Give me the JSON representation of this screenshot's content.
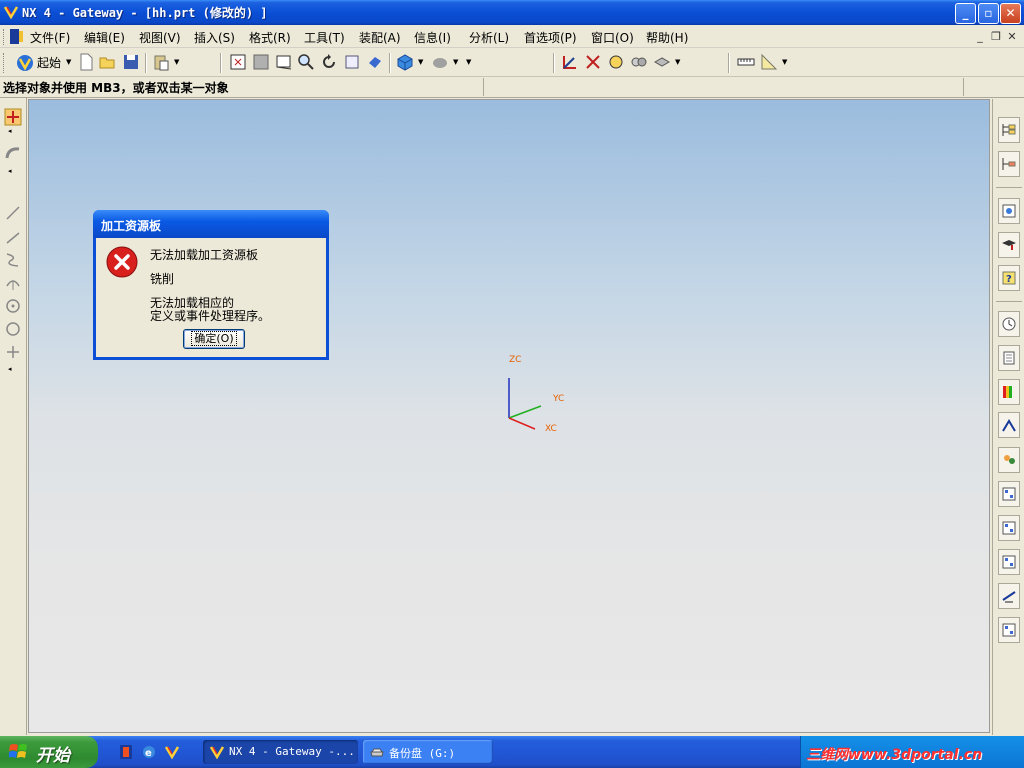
{
  "window": {
    "title": "NX 4 - Gateway - [hh.prt (修改的) ]"
  },
  "menu": {
    "items": [
      "文件(F)",
      "编辑(E)",
      "视图(V)",
      "插入(S)",
      "格式(R)",
      "工具(T)",
      "装配(A)",
      "信息(I)",
      "分析(L)",
      "首选项(P)",
      "窗口(O)",
      "帮助(H)"
    ]
  },
  "toolbar": {
    "start_label": "起始"
  },
  "cue": {
    "text": "选择对象并使用 MB3，或者双击某一对象"
  },
  "triad": {
    "zc": "ZC",
    "yc": "YC",
    "xc": "XC"
  },
  "dialog": {
    "title": "加工资源板",
    "line1": "无法加载加工资源板",
    "line2": "铣削",
    "line3": "无法加载相应的",
    "line4": "定义或事件处理程序。",
    "ok_label": "确定(O)"
  },
  "taskbar": {
    "start_label": "开始",
    "task1": "NX 4 - Gateway -...",
    "task2": "备份盘 (G:)",
    "watermark": "三维网www.3dportal.cn"
  },
  "colors": {
    "titlebar": "#0a4fd6",
    "error_icon": "#d8201c",
    "axis_x": "#e02020",
    "axis_y": "#20b020",
    "axis_z": "#2030c0",
    "tool_highlight": "#f9c870"
  }
}
